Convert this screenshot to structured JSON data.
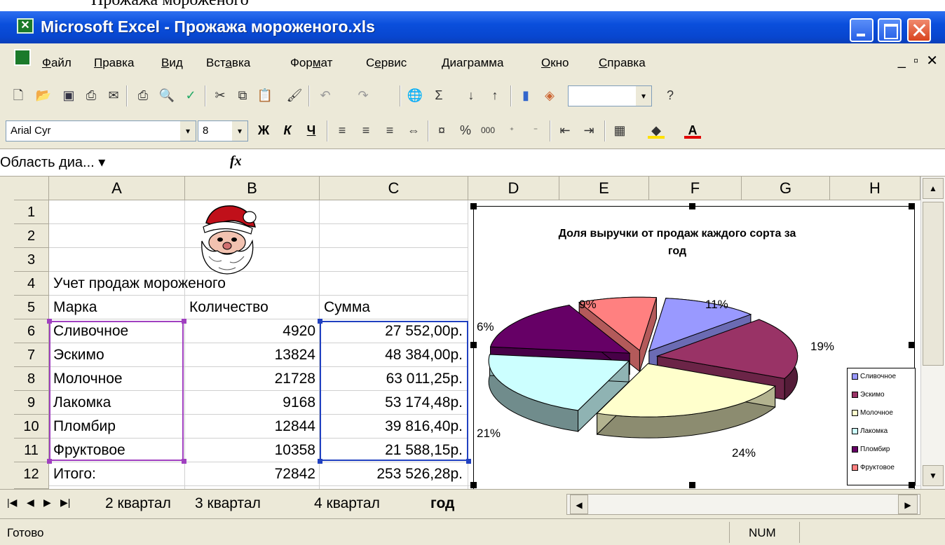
{
  "top_strip_text": "Прожажа мороженого",
  "window": {
    "title": "Microsoft Excel - Прожажа мороженого.xls"
  },
  "menu": {
    "items": [
      {
        "label": "Файл",
        "accel": "Ф",
        "rest": "айл"
      },
      {
        "label": "Правка",
        "accel": "П",
        "rest": "равка"
      },
      {
        "label": "Вид",
        "accel": "В",
        "rest": "ид"
      },
      {
        "label": "Вставка",
        "accel": "а",
        "pre": "Вст",
        "rest": "вка"
      },
      {
        "label": "Формат",
        "accel": "м",
        "pre": "Фор",
        "rest": "ат"
      },
      {
        "label": "Сервис",
        "accel": "е",
        "pre": "С",
        "rest": "рвис"
      },
      {
        "label": "Диаграмма",
        "accel": "Д",
        "rest": "иаграмма"
      },
      {
        "label": "Окно",
        "accel": "О",
        "rest": "кно"
      },
      {
        "label": "Справка",
        "accel": "С",
        "rest": "правка"
      }
    ]
  },
  "format_toolbar": {
    "font_name": "Arial Cyr",
    "font_size": "8",
    "bold": "Ж",
    "italic": "К",
    "underline": "Ч",
    "percent": "%",
    "thousands": "000"
  },
  "formula_bar": {
    "name_box": "Область диа...",
    "fx_label": "fx",
    "formula": ""
  },
  "grid": {
    "columns": [
      "A",
      "B",
      "C",
      "D",
      "E",
      "F",
      "G",
      "H"
    ],
    "rows": [
      "1",
      "2",
      "3",
      "4",
      "5",
      "6",
      "7",
      "8",
      "9",
      "10",
      "11",
      "12"
    ],
    "heading": "Учет продаж мороженого",
    "header_row": [
      "Марка",
      "Количество",
      "Сумма"
    ],
    "data_rows": [
      [
        "Сливочное",
        "4920",
        "27 552,00р."
      ],
      [
        "Эскимо",
        "13824",
        "48 384,00р."
      ],
      [
        "Молочное",
        "21728",
        "63 011,25р."
      ],
      [
        "Лакомка",
        "9168",
        "53 174,48р."
      ],
      [
        "Пломбир",
        "12844",
        "39 816,40р."
      ],
      [
        "Фруктовое",
        "10358",
        "21 588,15р."
      ]
    ],
    "total_row": [
      "Итого:",
      "72842",
      "253 526,28р."
    ]
  },
  "chart_data": {
    "type": "pie",
    "title": "Доля выручки от продаж каждого сорта за год",
    "title_lines": [
      "Доля выручки от продаж каждого сорта за",
      "год"
    ],
    "categories": [
      "Сливочное",
      "Эскимо",
      "Молочное",
      "Лакомка",
      "Пломбир",
      "Фруктовое"
    ],
    "values": [
      11,
      19,
      24,
      21,
      16,
      9
    ],
    "value_labels": [
      "11%",
      "19%",
      "24%",
      "21%",
      "6%",
      "9%"
    ],
    "colors": [
      "#9999ff",
      "#993366",
      "#ffffcc",
      "#ccffff",
      "#660066",
      "#ff8080"
    ],
    "legend_position": "right",
    "exploded": true,
    "three_d": true
  },
  "sheet_tabs": {
    "tabs": [
      "2 квартал",
      "3 квартал",
      "4 квартал",
      "год"
    ],
    "active": "год"
  },
  "status": {
    "text": "Готово",
    "num": "NUM"
  }
}
